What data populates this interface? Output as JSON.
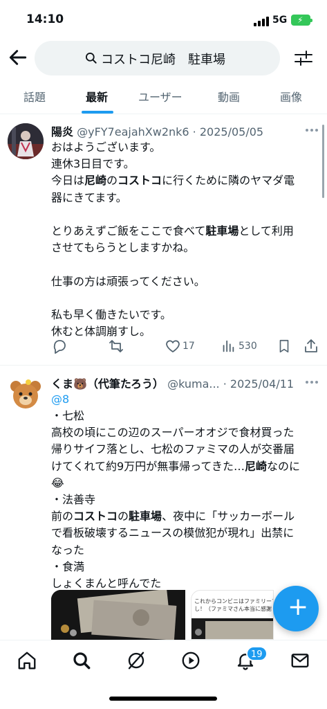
{
  "status_bar": {
    "time": "14:10",
    "network": "5G"
  },
  "search": {
    "query": "コストコ尼崎　駐車場"
  },
  "tabs": [
    {
      "label": "話題"
    },
    {
      "label": "最新"
    },
    {
      "label": "ユーザー"
    },
    {
      "label": "動画"
    },
    {
      "label": "画像"
    }
  ],
  "active_tab": "最新",
  "tweets": [
    {
      "name": "陽炎",
      "handle_date": "@yFY7eajahXw2nk6 · 2025/05/05",
      "lines": [
        "おはようございます。",
        "連休3日目です。",
        [
          "今日は",
          {
            "b": "尼崎"
          },
          "の",
          {
            "b": "コストコ"
          },
          "に行くために隣のヤマダ電"
        ],
        "器にきてます。",
        "",
        [
          "とりあえずご飯をここで食べて",
          {
            "b": "駐車場"
          },
          "として利用"
        ],
        "させてもらうとしますかね。",
        "",
        "仕事の方は頑張ってください。",
        "",
        "私も早く働きたいです。",
        "休むと体調崩すし。"
      ],
      "likes": "17",
      "views": "530"
    },
    {
      "name": "くま🐻（代筆たろう）",
      "handle_date": "@kuma... · 2025/04/11",
      "reply_to": "@8",
      "lines": [
        "・七松",
        "高校の頃にこの辺のスーパーオオジで食材買った",
        "帰りサイフ落とし、七松のファミマの人が交番届",
        [
          "けてくれて約9万円が無事帰ってきた…",
          {
            "b": "尼崎"
          },
          "なのに"
        ],
        "😂",
        "・法善寺",
        [
          "前の",
          {
            "b": "コストコ"
          },
          "の",
          {
            "b": "駐車場"
          },
          "、夜中に「サッカーボール"
        ],
        "で看板破壊するニュースの模倣犯が現れ」出禁に",
        "なった",
        "・食満",
        "しょくまんと呼んでた"
      ],
      "media_caption": "これからコンビニはファミリーマー\nし！（ファミマさん本当に感謝"
    }
  ],
  "notifications_badge": "19",
  "colors": {
    "accent": "#1d9bf0",
    "text": "#0f1419",
    "muted": "#536471"
  }
}
